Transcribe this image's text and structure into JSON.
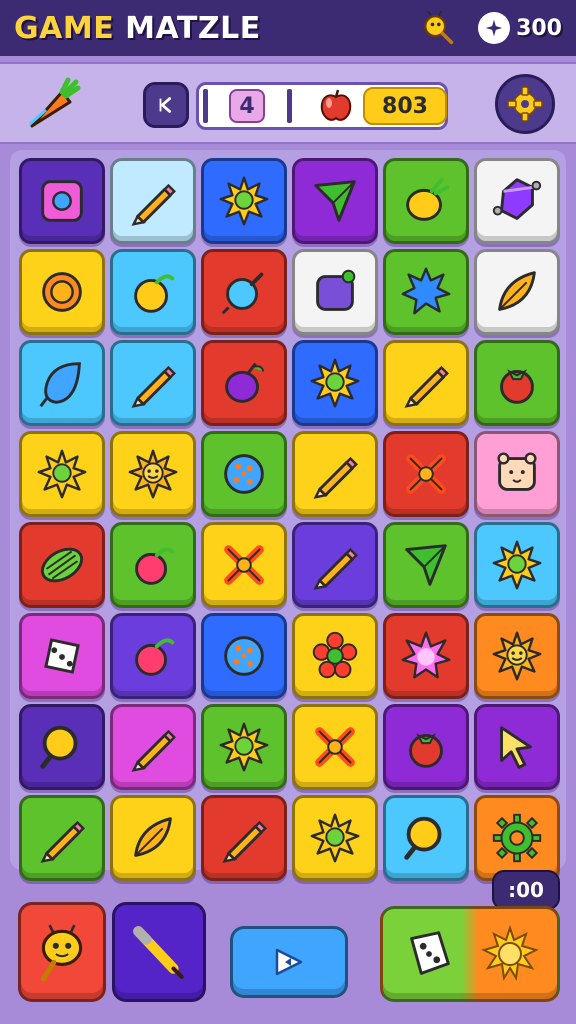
{
  "app": {
    "title_accent": "GAM",
    "title_accent_letter": "E",
    "title_rest": " MATZLE",
    "coins": "300"
  },
  "hud": {
    "moves": "4",
    "score": "803"
  },
  "timer": ":00",
  "colors": {
    "yellow": "#ffd21a",
    "blue": "#2f6bff",
    "cyan": "#4cc8ff",
    "red": "#e23b2e",
    "green": "#5dc22c",
    "purple": "#8e2bd6",
    "magenta": "#e04be0",
    "orange": "#ff8a1f",
    "white": "#f4f4f4",
    "lightblue": "#bfeaff",
    "pink": "#ff9fd6",
    "darkpurple": "#5a2fb8",
    "violet": "#6a3ddc"
  },
  "board": [
    [
      {
        "bg": "darkpurple",
        "icon": "box-icon"
      },
      {
        "bg": "lightblue",
        "icon": "pencil-icon"
      },
      {
        "bg": "blue",
        "icon": "sun-icon"
      },
      {
        "bg": "purple",
        "icon": "arrow-icon"
      },
      {
        "bg": "green",
        "icon": "lemon-icon"
      },
      {
        "bg": "white",
        "icon": "gem-icon"
      }
    ],
    [
      {
        "bg": "yellow",
        "icon": "ring-icon"
      },
      {
        "bg": "cyan",
        "icon": "fruit-icon"
      },
      {
        "bg": "red",
        "icon": "orb-icon"
      },
      {
        "bg": "white",
        "icon": "jar-icon"
      },
      {
        "bg": "green",
        "icon": "splat-icon"
      },
      {
        "bg": "white",
        "icon": "leaf-icon"
      }
    ],
    [
      {
        "bg": "cyan",
        "icon": "drop-icon"
      },
      {
        "bg": "cyan",
        "icon": "pencil-icon"
      },
      {
        "bg": "red",
        "icon": "plum-icon"
      },
      {
        "bg": "blue",
        "icon": "sun-icon"
      },
      {
        "bg": "yellow",
        "icon": "pencil-icon"
      },
      {
        "bg": "green",
        "icon": "tomato-icon"
      }
    ],
    [
      {
        "bg": "yellow",
        "icon": "sun-icon"
      },
      {
        "bg": "yellow",
        "icon": "smiley-sun-icon"
      },
      {
        "bg": "green",
        "icon": "dots-icon"
      },
      {
        "bg": "yellow",
        "icon": "pencil-icon"
      },
      {
        "bg": "red",
        "icon": "cross-icon"
      },
      {
        "bg": "pink",
        "icon": "bear-icon"
      }
    ],
    [
      {
        "bg": "red",
        "icon": "melon-icon"
      },
      {
        "bg": "green",
        "icon": "berry-icon"
      },
      {
        "bg": "yellow",
        "icon": "cross-icon"
      },
      {
        "bg": "violet",
        "icon": "pencil-icon"
      },
      {
        "bg": "green",
        "icon": "arrow-icon"
      },
      {
        "bg": "cyan",
        "icon": "sun-icon"
      }
    ],
    [
      {
        "bg": "magenta",
        "icon": "dice-icon"
      },
      {
        "bg": "violet",
        "icon": "berry-icon"
      },
      {
        "bg": "blue",
        "icon": "dots-icon"
      },
      {
        "bg": "yellow",
        "icon": "flower-icon"
      },
      {
        "bg": "red",
        "icon": "burst-icon"
      },
      {
        "bg": "orange",
        "icon": "smiley-sun-icon"
      }
    ],
    [
      {
        "bg": "darkpurple",
        "icon": "magnifier-icon"
      },
      {
        "bg": "magenta",
        "icon": "pencil-icon"
      },
      {
        "bg": "green",
        "icon": "sun-icon"
      },
      {
        "bg": "yellow",
        "icon": "cross-icon"
      },
      {
        "bg": "purple",
        "icon": "tomato-icon"
      },
      {
        "bg": "purple",
        "icon": "cursor-icon"
      }
    ],
    [
      {
        "bg": "green",
        "icon": "pencil-icon"
      },
      {
        "bg": "yellow",
        "icon": "leaf-icon"
      },
      {
        "bg": "red",
        "icon": "pencil-icon"
      },
      {
        "bg": "yellow",
        "icon": "sun-icon"
      },
      {
        "bg": "cyan",
        "icon": "magnifier-icon"
      },
      {
        "bg": "orange",
        "icon": "gear-icon"
      }
    ]
  ]
}
